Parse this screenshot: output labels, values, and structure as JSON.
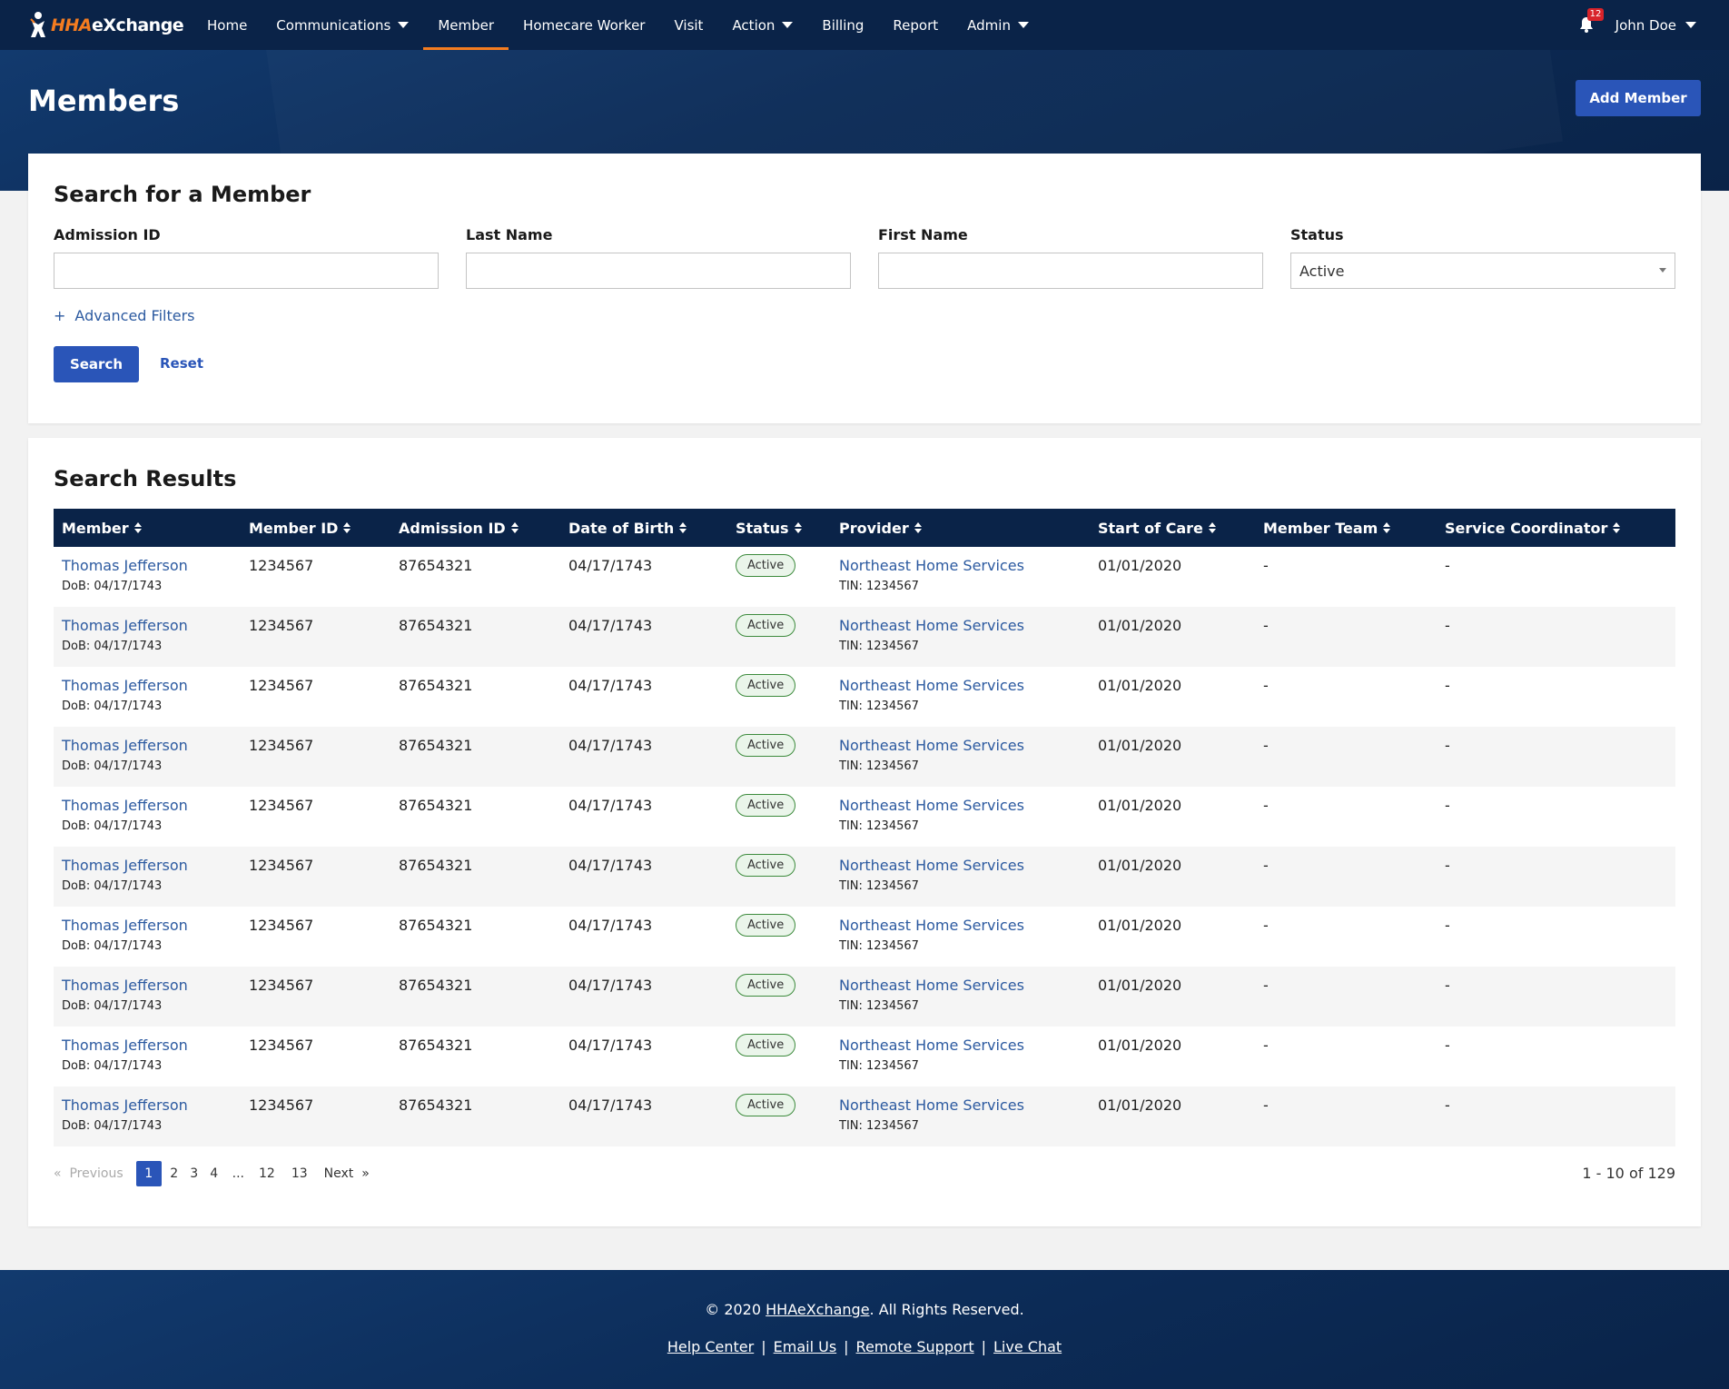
{
  "brand": {
    "logo_hha": "HHA",
    "logo_ex": "eXchange"
  },
  "nav": {
    "items": [
      {
        "label": "Home",
        "dropdown": false
      },
      {
        "label": "Communications",
        "dropdown": true
      },
      {
        "label": "Member",
        "dropdown": false,
        "active": true
      },
      {
        "label": "Homecare Worker",
        "dropdown": false
      },
      {
        "label": "Visit",
        "dropdown": false
      },
      {
        "label": "Action",
        "dropdown": true
      },
      {
        "label": "Billing",
        "dropdown": false
      },
      {
        "label": "Report",
        "dropdown": false
      },
      {
        "label": "Admin",
        "dropdown": true
      }
    ],
    "notification_count": "12",
    "user_name": "John Doe"
  },
  "header": {
    "title": "Members",
    "add_button": "Add Member"
  },
  "search": {
    "title": "Search for a Member",
    "fields": {
      "admission_id": {
        "label": "Admission ID",
        "value": ""
      },
      "last_name": {
        "label": "Last Name",
        "value": ""
      },
      "first_name": {
        "label": "First Name",
        "value": ""
      },
      "status": {
        "label": "Status",
        "value": "Active"
      }
    },
    "advanced_filters": "Advanced Filters",
    "advanced_prefix": "+",
    "search_button": "Search",
    "reset_button": "Reset"
  },
  "results": {
    "title": "Search Results",
    "columns": [
      "Member",
      "Member ID",
      "Admission ID",
      "Date of Birth",
      "Status",
      "Provider",
      "Start of Care",
      "Member Team",
      "Service Coordinator"
    ],
    "rows": [
      {
        "member": "Thomas Jefferson",
        "dob_sub": "DoB: 04/17/1743",
        "member_id": "1234567",
        "admission_id": "87654321",
        "dob": "04/17/1743",
        "status": "Active",
        "provider": "Northeast Home Services",
        "tin": "TIN: 1234567",
        "start_of_care": "01/01/2020",
        "member_team": "-",
        "service_coordinator": "-"
      },
      {
        "member": "Thomas Jefferson",
        "dob_sub": "DoB: 04/17/1743",
        "member_id": "1234567",
        "admission_id": "87654321",
        "dob": "04/17/1743",
        "status": "Active",
        "provider": "Northeast Home Services",
        "tin": "TIN: 1234567",
        "start_of_care": "01/01/2020",
        "member_team": "-",
        "service_coordinator": "-"
      },
      {
        "member": "Thomas Jefferson",
        "dob_sub": "DoB: 04/17/1743",
        "member_id": "1234567",
        "admission_id": "87654321",
        "dob": "04/17/1743",
        "status": "Active",
        "provider": "Northeast Home Services",
        "tin": "TIN: 1234567",
        "start_of_care": "01/01/2020",
        "member_team": "-",
        "service_coordinator": "-"
      },
      {
        "member": "Thomas Jefferson",
        "dob_sub": "DoB: 04/17/1743",
        "member_id": "1234567",
        "admission_id": "87654321",
        "dob": "04/17/1743",
        "status": "Active",
        "provider": "Northeast Home Services",
        "tin": "TIN: 1234567",
        "start_of_care": "01/01/2020",
        "member_team": "-",
        "service_coordinator": "-"
      },
      {
        "member": "Thomas Jefferson",
        "dob_sub": "DoB: 04/17/1743",
        "member_id": "1234567",
        "admission_id": "87654321",
        "dob": "04/17/1743",
        "status": "Active",
        "provider": "Northeast Home Services",
        "tin": "TIN: 1234567",
        "start_of_care": "01/01/2020",
        "member_team": "-",
        "service_coordinator": "-"
      },
      {
        "member": "Thomas Jefferson",
        "dob_sub": "DoB: 04/17/1743",
        "member_id": "1234567",
        "admission_id": "87654321",
        "dob": "04/17/1743",
        "status": "Active",
        "provider": "Northeast Home Services",
        "tin": "TIN: 1234567",
        "start_of_care": "01/01/2020",
        "member_team": "-",
        "service_coordinator": "-"
      },
      {
        "member": "Thomas Jefferson",
        "dob_sub": "DoB: 04/17/1743",
        "member_id": "1234567",
        "admission_id": "87654321",
        "dob": "04/17/1743",
        "status": "Active",
        "provider": "Northeast Home Services",
        "tin": "TIN: 1234567",
        "start_of_care": "01/01/2020",
        "member_team": "-",
        "service_coordinator": "-"
      },
      {
        "member": "Thomas Jefferson",
        "dob_sub": "DoB: 04/17/1743",
        "member_id": "1234567",
        "admission_id": "87654321",
        "dob": "04/17/1743",
        "status": "Active",
        "provider": "Northeast Home Services",
        "tin": "TIN: 1234567",
        "start_of_care": "01/01/2020",
        "member_team": "-",
        "service_coordinator": "-"
      },
      {
        "member": "Thomas Jefferson",
        "dob_sub": "DoB: 04/17/1743",
        "member_id": "1234567",
        "admission_id": "87654321",
        "dob": "04/17/1743",
        "status": "Active",
        "provider": "Northeast Home Services",
        "tin": "TIN: 1234567",
        "start_of_care": "01/01/2020",
        "member_team": "-",
        "service_coordinator": "-"
      },
      {
        "member": "Thomas Jefferson",
        "dob_sub": "DoB: 04/17/1743",
        "member_id": "1234567",
        "admission_id": "87654321",
        "dob": "04/17/1743",
        "status": "Active",
        "provider": "Northeast Home Services",
        "tin": "TIN: 1234567",
        "start_of_care": "01/01/2020",
        "member_team": "-",
        "service_coordinator": "-"
      }
    ],
    "pagination": {
      "previous": "Previous",
      "prev_arrow": "«",
      "pages": [
        "1",
        "2",
        "3",
        "4",
        "...",
        "12",
        "13"
      ],
      "current": "1",
      "next": "Next",
      "next_arrow": "»",
      "range_text": "1 - 10 of 129"
    }
  },
  "footer": {
    "copyright_prefix": "© 2020 ",
    "copyright_link": "HHAeXchange",
    "copyright_suffix": ". All Rights Reserved.",
    "links": [
      "Help Center",
      "Email Us",
      "Remote Support",
      "Live Chat"
    ],
    "separator": "|"
  },
  "colors": {
    "nav_bg": "#0a2348",
    "accent": "#f47c20",
    "primary": "#2a55b8",
    "link": "#2c5aa0",
    "status_green": "#3d8b3d"
  }
}
